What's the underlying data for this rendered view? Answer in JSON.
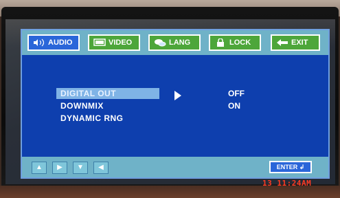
{
  "tabs": [
    {
      "label": "AUDIO",
      "icon": "speaker-icon",
      "active": true
    },
    {
      "label": "VIDEO",
      "icon": "monitor-icon",
      "active": false
    },
    {
      "label": "LANG",
      "icon": "language-icon",
      "active": false
    },
    {
      "label": "LOCK",
      "icon": "lock-icon",
      "active": false
    },
    {
      "label": "EXIT",
      "icon": "exit-arrow-icon",
      "active": false
    }
  ],
  "menu": [
    {
      "label": "DIGITAL OUT",
      "value": "OFF",
      "selected": true
    },
    {
      "label": "DOWNMIX",
      "value": "ON",
      "selected": false
    },
    {
      "label": "DYNAMIC RNG",
      "value": "",
      "selected": false
    }
  ],
  "bottom": {
    "nav_icons": [
      "up-arrow-icon",
      "right-arrow-icon",
      "down-arrow-icon",
      "left-arrow-icon"
    ],
    "enter_label": "ENTER"
  },
  "timestamp": "13 11:24AM",
  "colors": {
    "panel": "#0e3fae",
    "bar": "#6fb2c8",
    "tab_green": "#4da63a",
    "tab_active": "#2a66d9",
    "selection": "#7fb3e6",
    "timestamp": "#ff3a22"
  }
}
